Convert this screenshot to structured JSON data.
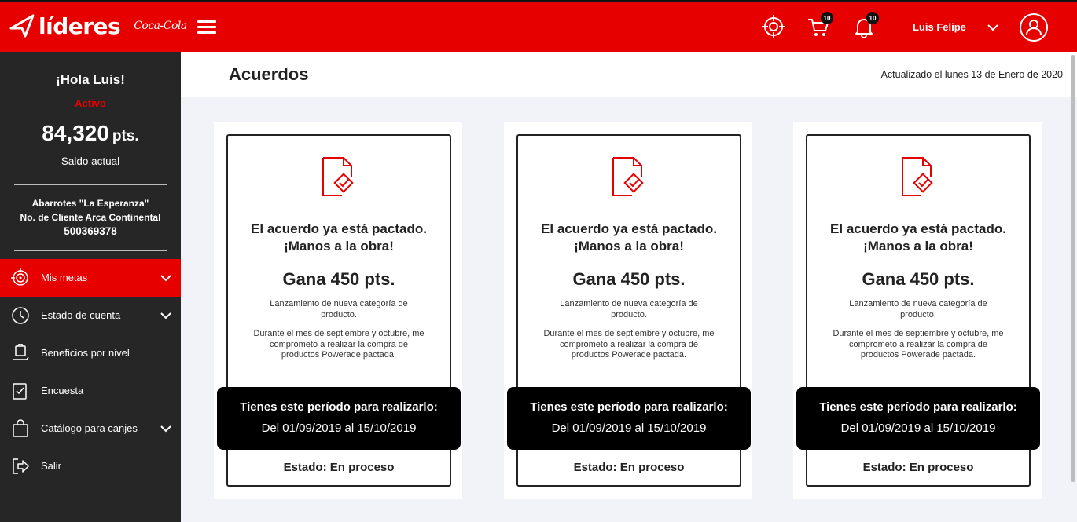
{
  "header": {
    "logo_text": "líderes",
    "logo_brand": "Coca-Cola",
    "cart_badge": "10",
    "bell_badge": "10",
    "user_name": "Luis Felipe"
  },
  "sidebar": {
    "greeting": "¡Hola Luis!",
    "status": "Activo",
    "points": "84,320",
    "points_unit": "pts.",
    "balance_label": "Saldo actual",
    "store_name": "Abarrotes \"La Esperanza\"",
    "client_label": "No. de Cliente Arca Continental",
    "client_number": "500369378",
    "items": [
      {
        "label": "Mis metas",
        "icon": "target-icon"
      },
      {
        "label": "Estado de cuenta",
        "icon": "clock-icon"
      },
      {
        "label": "Beneficios por nivel",
        "icon": "hand-bag-icon"
      },
      {
        "label": "Encuesta",
        "icon": "checklist-icon"
      },
      {
        "label": "Catálogo para canjes",
        "icon": "shopping-bag-icon"
      },
      {
        "label": "Salir",
        "icon": "logout-icon"
      }
    ]
  },
  "main": {
    "title": "Acuerdos",
    "updated": "Actualizado el lunes 13 de Enero de 2020",
    "cards": [
      {
        "msg_line1": "El acuerdo ya está pactado.",
        "msg_line2": "¡Manos a la obra!",
        "earn": "Gana 450 pts.",
        "sub": "Lanzamiento de nueva categoría de producto.",
        "desc": "Durante el mes de septiembre y octubre, me comprometo a realizar la compra de productos Powerade pactada.",
        "period_title": "Tienes este período para realizarlo:",
        "period_dates": "Del 01/09/2019 al 15/10/2019",
        "state": "Estado: En proceso"
      },
      {
        "msg_line1": "El acuerdo ya está pactado.",
        "msg_line2": "¡Manos a la obra!",
        "earn": "Gana 450 pts.",
        "sub": "Lanzamiento de nueva categoría de producto.",
        "desc": "Durante el mes de septiembre y octubre, me comprometo a realizar la compra de productos Powerade pactada.",
        "period_title": "Tienes este período para realizarlo:",
        "period_dates": "Del 01/09/2019 al 15/10/2019",
        "state": "Estado: En proceso"
      },
      {
        "msg_line1": "El acuerdo ya está pactado.",
        "msg_line2": "¡Manos a la obra!",
        "earn": "Gana 450 pts.",
        "sub": "Lanzamiento de nueva categoría de producto.",
        "desc": "Durante el mes de septiembre y octubre, me comprometo a realizar la compra de productos Powerade pactada.",
        "period_title": "Tienes este período para realizarlo:",
        "period_dates": "Del 01/09/2019 al 15/10/2019",
        "state": "Estado: En proceso"
      }
    ]
  },
  "colors": {
    "brand_red": "#e60000",
    "sidebar_bg": "#262626",
    "main_bg": "#f1f3f8"
  }
}
